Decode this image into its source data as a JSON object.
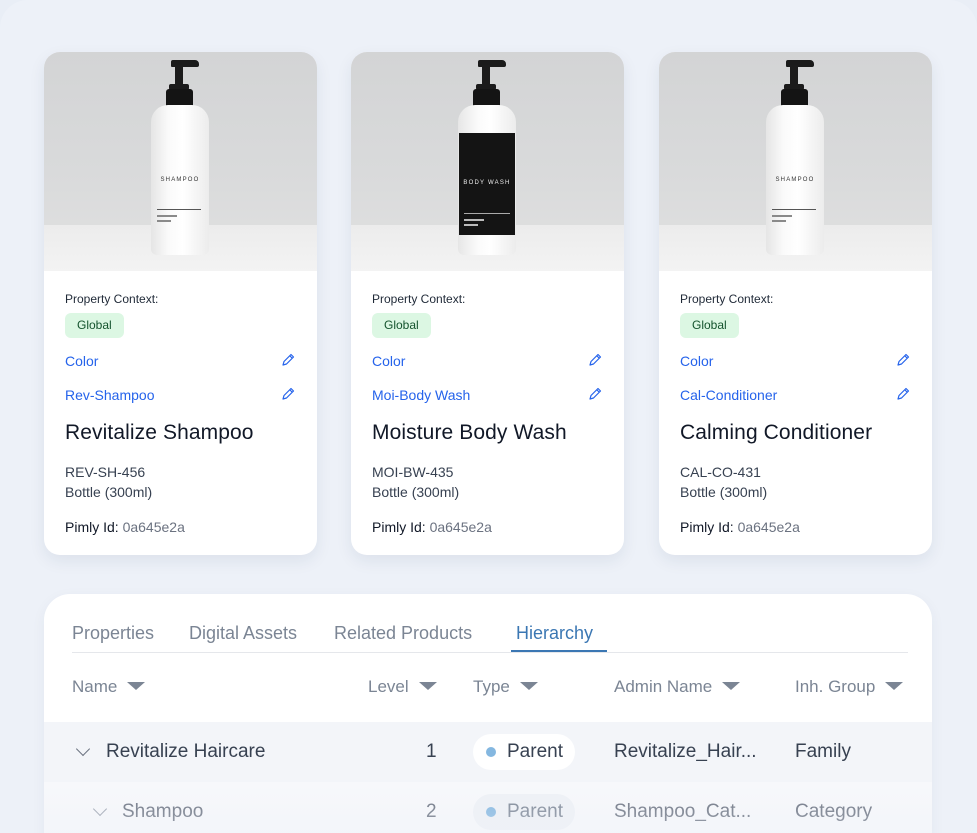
{
  "products": [
    {
      "bottle_label": "SHAMPOO",
      "context_label": "Property Context:",
      "context_badge": "Global",
      "attr1": "Color",
      "attr2": "Rev-Shampoo",
      "name": "Revitalize Shampoo",
      "sku": "REV-SH-456",
      "size": "Bottle (300ml)",
      "pimly_key": "Pimly Id:",
      "pimly_value": "0a645e2a"
    },
    {
      "bottle_label": "BODY WASH",
      "context_label": "Property Context:",
      "context_badge": "Global",
      "attr1": "Color",
      "attr2": "Moi-Body Wash",
      "name": "Moisture Body Wash",
      "sku": "MOI-BW-435",
      "size": "Bottle (300ml)",
      "pimly_key": "Pimly Id:",
      "pimly_value": "0a645e2a"
    },
    {
      "bottle_label": "SHAMPOO",
      "context_label": "Property Context:",
      "context_badge": "Global",
      "attr1": "Color",
      "attr2": "Cal-Conditioner",
      "name": "Calming Conditioner",
      "sku": "CAL-CO-431",
      "size": "Bottle (300ml)",
      "pimly_key": "Pimly Id:",
      "pimly_value": "0a645e2a"
    }
  ],
  "tabs": {
    "properties": "Properties",
    "digital_assets": "Digital Assets",
    "related_products": "Related Products",
    "hierarchy": "Hierarchy",
    "active": "Hierarchy"
  },
  "table": {
    "headers": {
      "name": "Name",
      "level": "Level",
      "type": "Type",
      "admin_name": "Admin Name",
      "inh_group": "Inh. Group"
    },
    "rows": [
      {
        "name": "Revitalize Haircare",
        "level": "1",
        "type": "Parent",
        "admin_name": "Revitalize_Hair...",
        "inh_group": "Family"
      },
      {
        "name": "Shampoo",
        "level": "2",
        "type": "Parent",
        "admin_name": "Shampoo_Cat...",
        "inh_group": "Category"
      }
    ]
  },
  "colors": {
    "link": "#2563eb",
    "badge_bg": "#dcf7e3",
    "tab_active": "#3b77b3",
    "type_dot": "#84b7e0"
  },
  "icons": [
    "pencil-icon",
    "chevron-down-icon",
    "caret-down-icon"
  ]
}
